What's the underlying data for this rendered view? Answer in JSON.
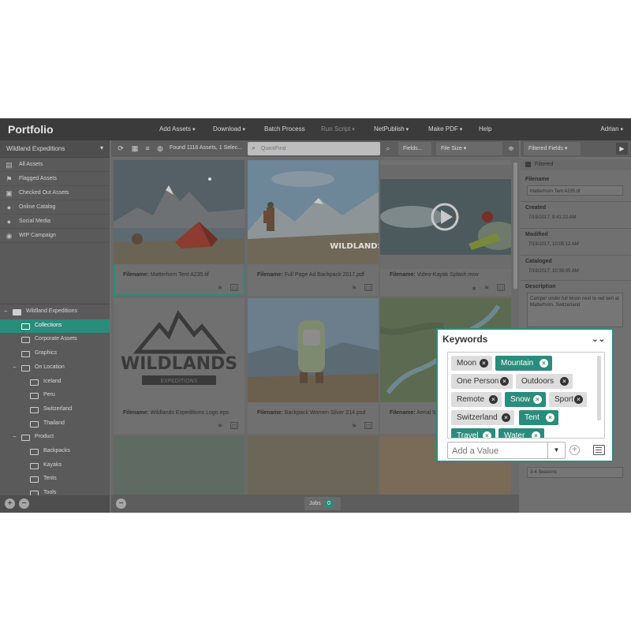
{
  "app": {
    "title": "Portfolio",
    "user": "Adrian",
    "menu": [
      {
        "label": "Add Assets",
        "dropdown": true,
        "dim": false
      },
      {
        "label": "Download",
        "dropdown": true,
        "dim": false
      },
      {
        "label": "Batch Process",
        "dropdown": false,
        "dim": false
      },
      {
        "label": "Run Script",
        "dropdown": true,
        "dim": true
      },
      {
        "label": "NetPublish",
        "dropdown": true,
        "dim": false
      },
      {
        "label": "Make PDF",
        "dropdown": true,
        "dim": false
      },
      {
        "label": "Help",
        "dropdown": false,
        "dim": false
      }
    ]
  },
  "sidebar": {
    "catalog": "Wildland Expeditions",
    "galleries": [
      {
        "label": "All Assets",
        "icon": "grid-icon"
      },
      {
        "label": "Flagged Assets",
        "icon": "flag-icon"
      },
      {
        "label": "Checked Out Assets",
        "icon": "checked-out-icon"
      },
      {
        "label": "Online Catalog",
        "icon": "person-icon"
      },
      {
        "label": "Social Media",
        "icon": "person-icon"
      },
      {
        "label": "WIP Campaign",
        "icon": "eye-icon"
      }
    ],
    "tree": [
      {
        "label": "Wildland Expeditions",
        "toggle": "−",
        "filled": true,
        "selected": false
      },
      {
        "label": "Collections",
        "toggle": "",
        "filled": false,
        "selected": true
      },
      {
        "label": "Corporate Assets",
        "toggle": "",
        "filled": false,
        "selected": false
      },
      {
        "label": "Graphics",
        "toggle": "",
        "filled": false,
        "selected": false
      },
      {
        "label": "On Location",
        "toggle": "−",
        "filled": false,
        "selected": false
      },
      {
        "label": "Iceland",
        "toggle": "",
        "filled": false,
        "selected": false
      },
      {
        "label": "Peru",
        "toggle": "",
        "filled": false,
        "selected": false
      },
      {
        "label": "Switzerland",
        "toggle": "",
        "filled": false,
        "selected": false
      },
      {
        "label": "Thailand",
        "toggle": "",
        "filled": false,
        "selected": false
      },
      {
        "label": "Product",
        "toggle": "−",
        "filled": false,
        "selected": false
      },
      {
        "label": "Backpacks",
        "toggle": "",
        "filled": false,
        "selected": false
      },
      {
        "label": "Kayaks",
        "toggle": "",
        "filled": false,
        "selected": false
      },
      {
        "label": "Tents",
        "toggle": "",
        "filled": false,
        "selected": false
      },
      {
        "label": "Tools",
        "toggle": "",
        "filled": false,
        "selected": false
      }
    ],
    "add_label": "+",
    "remove_label": "−"
  },
  "toolbar": {
    "found_text": "Found 1116 Assets, 1 Selec...",
    "search_placeholder": "QuickFind",
    "fields_label": "Fields...",
    "sort_label": "File Size",
    "filtered_fields_label": "Filtered Fields"
  },
  "assets": [
    {
      "filename_label": "Filename:",
      "filename": "Matterhorn Tent A235.tif",
      "selected": true,
      "scene": "tent"
    },
    {
      "filename_label": "Filename:",
      "filename": "Full Page Ad Backpack 2017.pdf",
      "selected": false,
      "scene": "hiker"
    },
    {
      "filename_label": "Filename:",
      "filename": "Video-Kayak Splash.mov",
      "selected": false,
      "scene": "kayak"
    },
    {
      "filename_label": "Filename:",
      "filename": "Wildlands Expeditions Logo.eps",
      "selected": false,
      "scene": "logo"
    },
    {
      "filename_label": "Filename:",
      "filename": "Backpack Women Silver 214.psd",
      "selected": false,
      "scene": "backpack"
    },
    {
      "filename_label": "Filename:",
      "filename": "Aerial 9...",
      "selected": false,
      "scene": "aerial"
    }
  ],
  "logo": {
    "word": "WILDLANDS",
    "sub": "EXPEDITIONS"
  },
  "jobs": {
    "label": "Jobs",
    "count": "0"
  },
  "details": {
    "section": "Filtered",
    "fields": [
      {
        "label": "Filename",
        "value": "Matterhorn Tent A235.tif",
        "boxed": true
      },
      {
        "label": "Created",
        "value": "7/19/2017, 9:41:22 AM",
        "boxed": false
      },
      {
        "label": "Modified",
        "value": "7/19/2017, 10:05:12 AM",
        "boxed": false
      },
      {
        "label": "Cataloged",
        "value": "7/19/2017, 10:35:05 AM",
        "boxed": false
      },
      {
        "label": "Description",
        "value": "Camper under full Moon next to red tent at Matterhorn, Switzerland",
        "boxed": true
      }
    ],
    "season": "3-4 Seasons"
  },
  "keywords": {
    "title": "Keywords",
    "chips": [
      {
        "label": "Moon",
        "teal": false
      },
      {
        "label": "Mountain",
        "teal": true
      },
      {
        "label": "One Person",
        "teal": false
      },
      {
        "label": "Outdoors",
        "teal": false
      },
      {
        "label": "Remote",
        "teal": false
      },
      {
        "label": "Snow",
        "teal": true
      },
      {
        "label": "Sport",
        "teal": false
      },
      {
        "label": "Switzerland",
        "teal": false
      },
      {
        "label": "Tent",
        "teal": true
      },
      {
        "label": "Travel",
        "teal": true
      },
      {
        "label": "Water",
        "teal": true
      }
    ],
    "placeholder": "Add a Value",
    "colors": {
      "accent": "#2a8c7b",
      "chip_gray": "#dddddd"
    }
  }
}
